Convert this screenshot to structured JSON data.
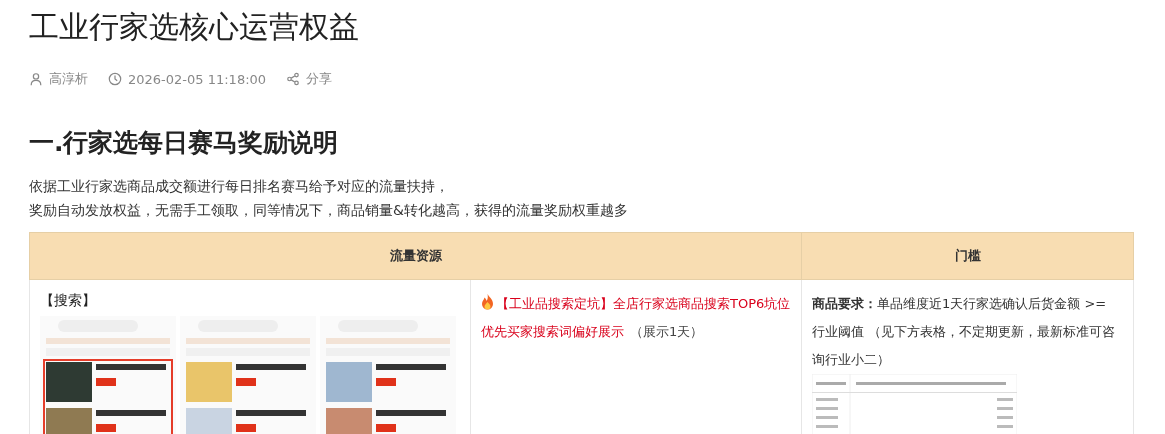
{
  "title": "工业行家选核心运营权益",
  "meta": {
    "author": "高淳析",
    "datetime": "2026-02-05 11:18:00",
    "share": "分享"
  },
  "section": {
    "heading": "一.行家选每日赛马奖励说明",
    "paragraph_lines": [
      "依据工业行家选商品成交额进行每日排名赛马给予对应的流量扶持，",
      "奖励自动发放权益，无需手工领取，同等情况下，商品销量&转化越高，获得的流量奖励权重越多"
    ]
  },
  "table": {
    "columns": [
      {
        "label": "流量资源"
      },
      {
        "label": "门槛"
      }
    ],
    "rows": [
      {
        "resource_label": "【搜索】",
        "benefit": {
          "text": "【工业品搜索定坑】全店行家选商品搜索TOP6坑位优先买家搜索词偏好展示",
          "note": "（展示1天）"
        },
        "requirement": {
          "label": "商品要求：",
          "text": "单品维度近1天行家选确认后货金额 >= 行业阈值 （见下方表格，不定期更新，最新标准可咨询行业小二）"
        }
      }
    ]
  }
}
